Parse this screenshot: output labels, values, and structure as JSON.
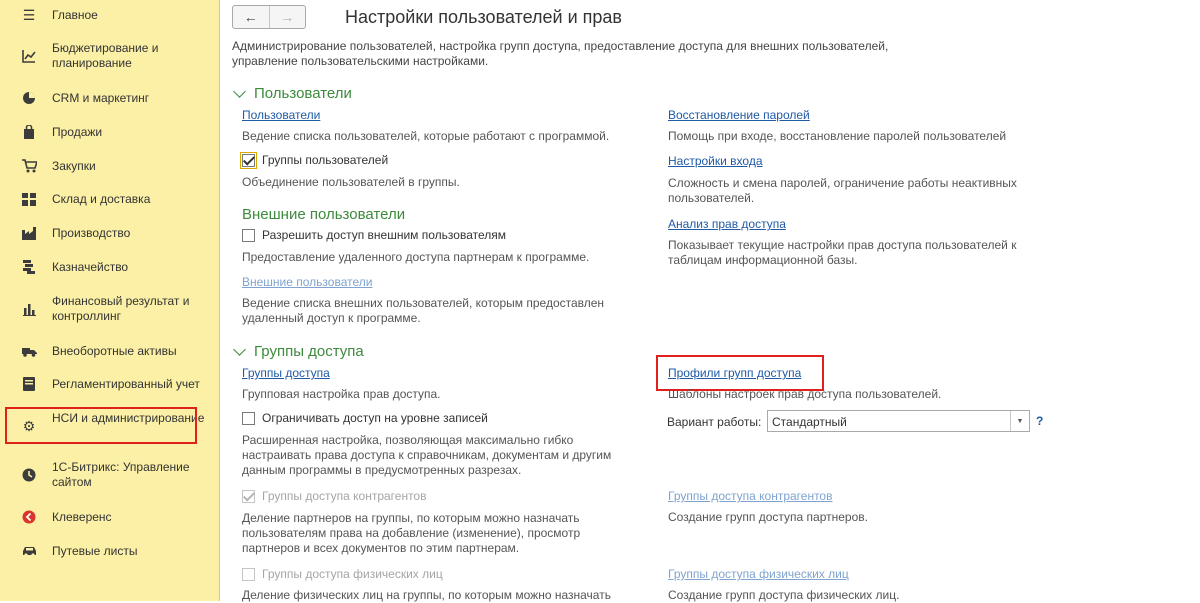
{
  "sidebar": {
    "items": [
      {
        "label": "Главное",
        "icon": "hamburger-icon"
      },
      {
        "label": "Бюджетирование и планирование",
        "icon": "chart-line-icon"
      },
      {
        "label": "CRM и маркетинг",
        "icon": "pie-icon"
      },
      {
        "label": "Продажи",
        "icon": "bag-icon"
      },
      {
        "label": "Закупки",
        "icon": "cart-icon"
      },
      {
        "label": "Склад и доставка",
        "icon": "warehouse-icon"
      },
      {
        "label": "Производство",
        "icon": "factory-icon"
      },
      {
        "label": "Казначейство",
        "icon": "coins-icon"
      },
      {
        "label": "Финансовый результат и контроллинг",
        "icon": "bar-chart-icon"
      },
      {
        "label": "Внеоборотные активы",
        "icon": "truck-icon"
      },
      {
        "label": "Регламентированный учет",
        "icon": "book-icon"
      },
      {
        "label": "НСИ и администрирование",
        "icon": "gear-icon"
      },
      {
        "label": "1С-Битрикс: Управление сайтом",
        "icon": "bitrix-icon"
      },
      {
        "label": "Клеверенс",
        "icon": "cleverence-icon"
      },
      {
        "label": "Путевые листы",
        "icon": "car-icon"
      }
    ]
  },
  "header": {
    "back": "←",
    "forward": "→",
    "title": "Настройки пользователей и прав",
    "description": "Администрирование пользователей, настройка групп доступа, предоставление доступа для внешних пользователей, управление пользовательскими настройками."
  },
  "users": {
    "title": "Пользователи",
    "users_link": "Пользователи",
    "users_desc": "Ведение списка пользователей, которые работают с программой.",
    "groups_check": "Группы пользователей",
    "groups_desc": "Объединение пользователей в группы.",
    "external_title": "Внешние пользователи",
    "external_check": "Разрешить доступ внешним пользователям",
    "external_check_desc": "Предоставление удаленного доступа партнерам к программе.",
    "external_link": "Внешние пользователи",
    "external_link_desc": "Ведение списка внешних пользователей, которым предоставлен удаленный доступ к программе.",
    "restore_link": "Восстановление паролей",
    "restore_desc": "Помощь при входе, восстановление паролей пользователей",
    "login_link": "Настройки входа",
    "login_desc": "Сложность и смена паролей, ограничение работы неактивных пользователей.",
    "analysis_link": "Анализ прав доступа",
    "analysis_desc": "Показывает текущие настройки прав доступа пользователей к таблицам информационной базы."
  },
  "access": {
    "title": "Группы доступа",
    "groups_link": "Группы доступа",
    "groups_desc": "Групповая настройка прав доступа.",
    "records_check": "Ограничивать доступ на уровне записей",
    "records_desc": "Расширенная настройка, позволяющая максимально гибко настраивать права доступа к справочникам, документам и другим данным программы в предусмотренных разрезах.",
    "contractors_check": "Группы доступа контрагентов",
    "contractors_desc": "Деление партнеров на группы, по которым можно назначать пользователям права на добавление (изменение), просмотр партнеров и всех документов по этим партнерам.",
    "individuals_check": "Группы доступа физических лиц",
    "individuals_desc": "Деление физических лиц на группы, по которым можно назначать",
    "profiles_link": "Профили групп доступа",
    "profiles_desc": "Шаблоны настроек прав доступа пользователей.",
    "mode_label": "Вариант работы:",
    "mode_value": "Стандартный",
    "help": "?",
    "contractors_link": "Группы доступа контрагентов",
    "contractors_link_desc": "Создание групп доступа партнеров.",
    "individuals_link": "Группы доступа физических лиц",
    "individuals_link_desc": "Создание групп доступа физических лиц."
  }
}
